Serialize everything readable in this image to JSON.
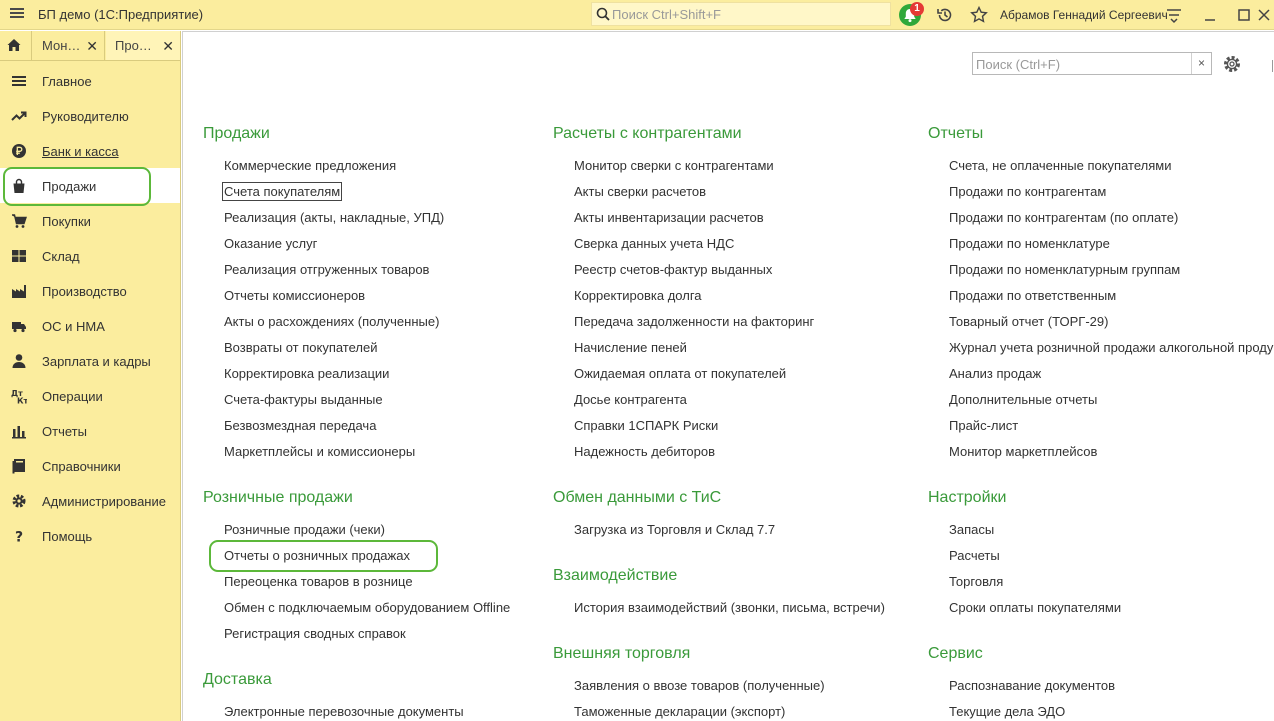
{
  "window": {
    "title": "БП демо  (1С:Предприятие)",
    "search_placeholder": "Поиск Ctrl+Shift+F",
    "notification_count": "1",
    "user": "Абрамов Геннадий Сергеевич"
  },
  "tabs": [
    {
      "label": "Мон…"
    },
    {
      "label": "Про…"
    }
  ],
  "sidebar": {
    "items": [
      {
        "label": "Главное",
        "icon": "menu-lines-icon"
      },
      {
        "label": "Руководителю",
        "icon": "trend-up-icon"
      },
      {
        "label": "Банк и касса",
        "icon": "ruble-coin-icon"
      },
      {
        "label": "Продажи",
        "icon": "shopping-bag-icon",
        "active": true
      },
      {
        "label": "Покупки",
        "icon": "cart-icon"
      },
      {
        "label": "Склад",
        "icon": "warehouse-icon"
      },
      {
        "label": "Производство",
        "icon": "factory-icon"
      },
      {
        "label": "ОС и НМА",
        "icon": "truck-icon"
      },
      {
        "label": "Зарплата и кадры",
        "icon": "person-icon"
      },
      {
        "label": "Операции",
        "icon": "dt-kt-icon"
      },
      {
        "label": "Отчеты",
        "icon": "bar-chart-icon"
      },
      {
        "label": "Справочники",
        "icon": "book-icon"
      },
      {
        "label": "Администрирование",
        "icon": "gear-icon"
      },
      {
        "label": "Помощь",
        "icon": "question-icon"
      }
    ]
  },
  "main": {
    "search_placeholder": "Поиск (Ctrl+F)",
    "clear_label": "×",
    "columns": [
      {
        "sections": [
          {
            "title": "Продажи",
            "links": [
              "Коммерческие предложения",
              "Счета покупателям",
              "Реализация (акты, накладные, УПД)",
              "Оказание услуг",
              "Реализация отгруженных товаров",
              "Отчеты комиссионеров",
              "Акты о расхождениях (полученные)",
              "Возвраты от покупателей",
              "Корректировка реализации",
              "Счета-фактуры выданные",
              "Безвозмездная передача",
              "Маркетплейсы и комиссионеры"
            ]
          },
          {
            "title": "Розничные продажи",
            "links": [
              "Розничные продажи (чеки)",
              "Отчеты о розничных продажах",
              "Переоценка товаров в рознице",
              "Обмен с подключаемым оборудованием Offline",
              "Регистрация сводных справок"
            ]
          },
          {
            "title": "Доставка",
            "links": [
              "Электронные перевозочные документы"
            ]
          }
        ]
      },
      {
        "sections": [
          {
            "title": "Расчеты с контрагентами",
            "links": [
              "Монитор сверки с контрагентами",
              "Акты сверки расчетов",
              "Акты инвентаризации расчетов",
              "Сверка данных учета НДС",
              "Реестр счетов-фактур выданных",
              "Корректировка долга",
              "Передача задолженности на факторинг",
              "Начисление пеней",
              "Ожидаемая оплата от покупателей",
              "Досье контрагента",
              "Справки 1СПАРК Риски",
              "Надежность дебиторов"
            ]
          },
          {
            "title": "Обмен данными с ТиС",
            "links": [
              "Загрузка из Торговля и Склад 7.7"
            ]
          },
          {
            "title": "Взаимодействие",
            "links": [
              "История взаимодействий (звонки, письма, встречи)"
            ]
          },
          {
            "title": "Внешняя торговля",
            "links": [
              "Заявления о ввозе товаров (полученные)",
              "Таможенные декларации (экспорт)"
            ]
          }
        ]
      },
      {
        "sections": [
          {
            "title": "Отчеты",
            "links": [
              "Счета, не оплаченные покупателями",
              "Продажи по контрагентам",
              "Продажи по контрагентам (по оплате)",
              "Продажи по номенклатуре",
              "Продажи по номенклатурным группам",
              "Продажи по ответственным",
              "Товарный отчет (ТОРГ-29)",
              "Журнал учета розничной продажи алкогольной продукции",
              "Анализ продаж",
              "Дополнительные отчеты",
              "Прайс-лист",
              "Монитор маркетплейсов"
            ]
          },
          {
            "title": "Настройки",
            "links": [
              "Запасы",
              "Расчеты",
              "Торговля",
              "Сроки оплаты покупателями"
            ]
          },
          {
            "title": "Сервис",
            "links": [
              "Распознавание документов",
              "Текущие дела ЭДО"
            ]
          }
        ]
      }
    ]
  },
  "colors": {
    "accent_green": "#3a9a3a",
    "highlight_green": "#5cb83a",
    "sidebar_yellow": "#fbed9e"
  }
}
